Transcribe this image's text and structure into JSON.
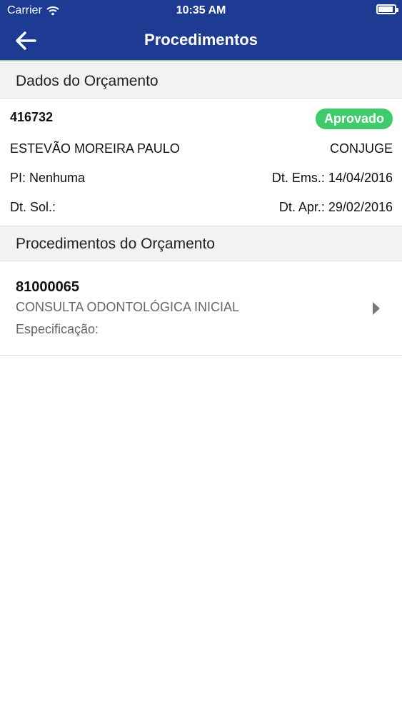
{
  "status_bar": {
    "carrier": "Carrier",
    "time": "10:35 AM",
    "battery_level": 0.85,
    "icons": [
      "wifi-icon",
      "battery-icon"
    ]
  },
  "nav": {
    "title": "Procedimentos",
    "back_icon": "arrow-left-icon"
  },
  "colors": {
    "header_bg": "#1d3b92",
    "badge_bg": "#3fcb6b",
    "section_bg": "#f2f2f2"
  },
  "budget": {
    "section_title": "Dados do Orçamento",
    "number": "416732",
    "status": "Aprovado",
    "patient": "ESTEVÃO MOREIRA PAULO",
    "relationship": "CONJUGE",
    "pi_label": "PI: Nenhuma",
    "dt_ems": "Dt. Ems.: 14/04/2016",
    "dt_sol": "Dt. Sol.:",
    "dt_apr": "Dt. Apr.: 29/02/2016"
  },
  "procedures": {
    "section_title": "Procedimentos do Orçamento",
    "items": [
      {
        "code": "81000065",
        "description": "CONSULTA ODONTOLÓGICA INICIAL",
        "specification": "Especificação:",
        "icon": "chevron-right-icon"
      }
    ]
  }
}
